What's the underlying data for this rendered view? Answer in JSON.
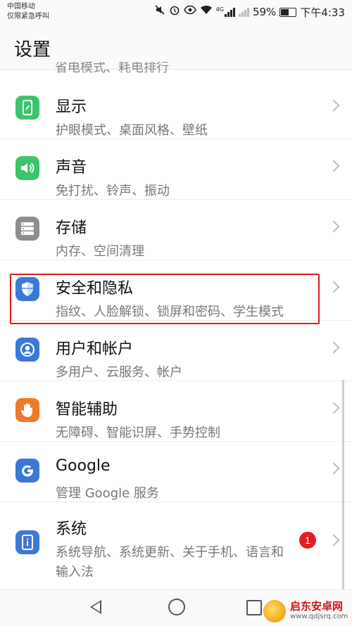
{
  "statusbar": {
    "carrier_line1": "中国移动",
    "carrier_line2": "仅限紧急呼叫",
    "network": "4G",
    "battery": "59%",
    "time": "下午4:33",
    "icons": [
      "mute-icon",
      "alarm-icon",
      "eye-icon",
      "wifi-icon",
      "signal-icon",
      "battery-icon"
    ]
  },
  "header": {
    "title": "设置"
  },
  "partial_item": {
    "subtitle": "省电模式、耗电排行"
  },
  "items": [
    {
      "title": "显示",
      "subtitle": "护眼模式、桌面风格、壁纸",
      "icon": "display-icon",
      "color": "#3cc46a"
    },
    {
      "title": "声音",
      "subtitle": "免打扰、铃声、振动",
      "icon": "speaker-icon",
      "color": "#3cc46a"
    },
    {
      "title": "存储",
      "subtitle": "内存、空间清理",
      "icon": "storage-icon",
      "color": "#8e8e8e"
    },
    {
      "title": "安全和隐私",
      "subtitle": "指纹、人脸解锁、锁屏和密码、学生模式",
      "icon": "shield-icon",
      "color": "#3a78d6"
    },
    {
      "title": "用户和帐户",
      "subtitle": "多用户、云服务、帐户",
      "icon": "user-icon",
      "color": "#3a78d6"
    },
    {
      "title": "智能辅助",
      "subtitle": "无障碍、智能识屏、手势控制",
      "icon": "hand-icon",
      "color": "#f0782a"
    },
    {
      "title": "Google",
      "subtitle": "管理 Google 服务",
      "icon": "google-icon",
      "color": "#3a78d6"
    },
    {
      "title": "系统",
      "subtitle": "系统导航、系统更新、关于手机、语言和输入法",
      "icon": "system-info-icon",
      "color": "#3a78d6",
      "badge": "1"
    }
  ],
  "watermark": {
    "name": "启东安卓网",
    "url": "www.qdjsrq.com"
  },
  "colors": {
    "highlight": "#e01a1a",
    "badge": "#e02020"
  }
}
